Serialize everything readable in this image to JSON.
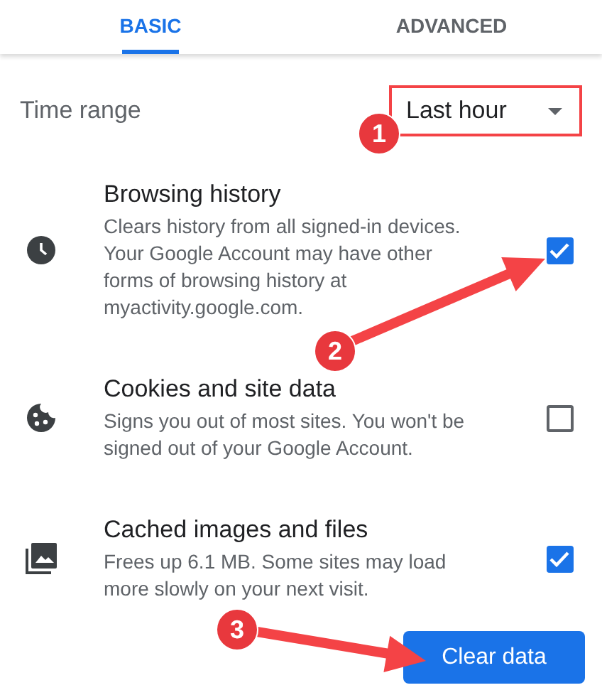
{
  "tabs": [
    {
      "label": "BASIC",
      "selected": true
    },
    {
      "label": "ADVANCED",
      "selected": false
    }
  ],
  "time_range": {
    "label": "Time range",
    "value": "Last hour",
    "highlighted": true
  },
  "items": [
    {
      "kind": "history",
      "title": "Browsing history",
      "description": "Clears history from all signed-in devices. Your Google Account may have other forms of browsing history at myactivity.google.com.",
      "checked": true
    },
    {
      "kind": "cookies",
      "title": "Cookies and site data",
      "description": "Signs you out of most sites. You won't be signed out of your Google Account.",
      "checked": false
    },
    {
      "kind": "images",
      "title": "Cached images and files",
      "description": "Frees up 6.1 MB. Some sites may load more slowly on your next visit.",
      "checked": true
    }
  ],
  "button": "Clear data",
  "annotations": [
    {
      "number": "1"
    },
    {
      "number": "2"
    },
    {
      "number": "3"
    }
  ]
}
